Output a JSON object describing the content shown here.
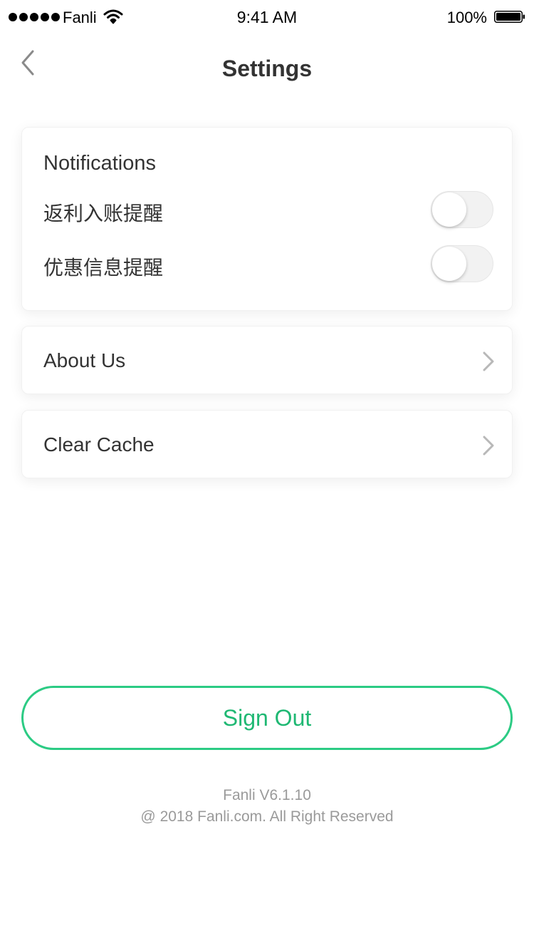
{
  "status_bar": {
    "carrier": "Fanli",
    "time": "9:41 AM",
    "battery": "100%",
    "signal_icon": "signal-dots-icon",
    "wifi_icon": "wifi-icon",
    "battery_icon": "battery-full-icon"
  },
  "nav": {
    "title": "Settings",
    "back_icon": "chevron-left-icon"
  },
  "notifications": {
    "title": "Notifications",
    "items": [
      {
        "label": "返利入账提醒",
        "enabled": false
      },
      {
        "label": "优惠信息提醒",
        "enabled": false
      }
    ]
  },
  "menu": {
    "about": "About Us",
    "clear_cache": "Clear Cache",
    "chevron_icon": "chevron-right-icon"
  },
  "sign_out": {
    "label": "Sign Out",
    "accent_color": "#2ccb84"
  },
  "footer": {
    "version": "Fanli V6.1.10",
    "copyright": "@ 2018 Fanli.com. All Right Reserved"
  }
}
